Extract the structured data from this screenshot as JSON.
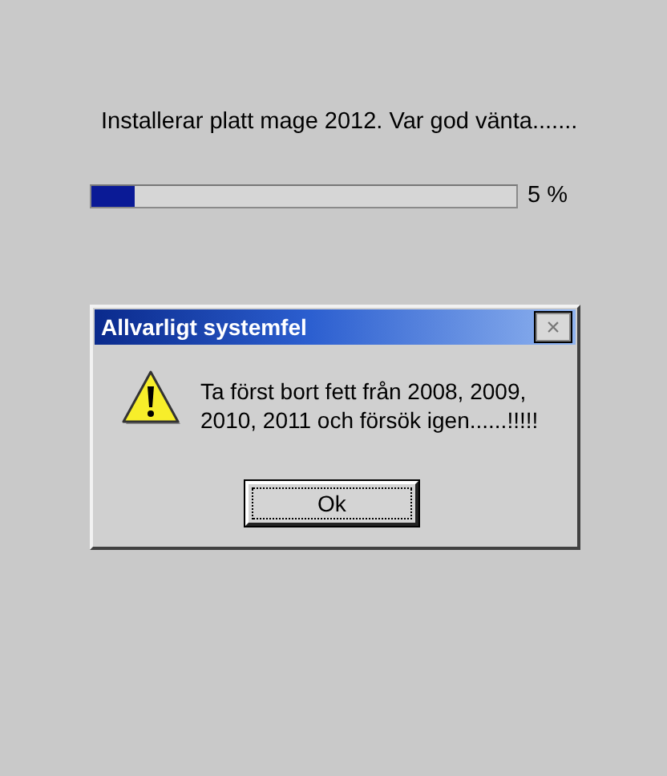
{
  "installer": {
    "message": "Installerar platt mage 2012. Var god vänta.......",
    "progress": {
      "level": 0.1,
      "reading": "5 %"
    }
  },
  "dialog": {
    "title": "Allvarligt systemfel",
    "close": "×",
    "message": "Ta först bort fett från 2008, 2009, 2010, 2011 och försök igen......!!!!!",
    "buttons": [
      {
        "label": "Ok",
        "focused": true
      }
    ]
  }
}
